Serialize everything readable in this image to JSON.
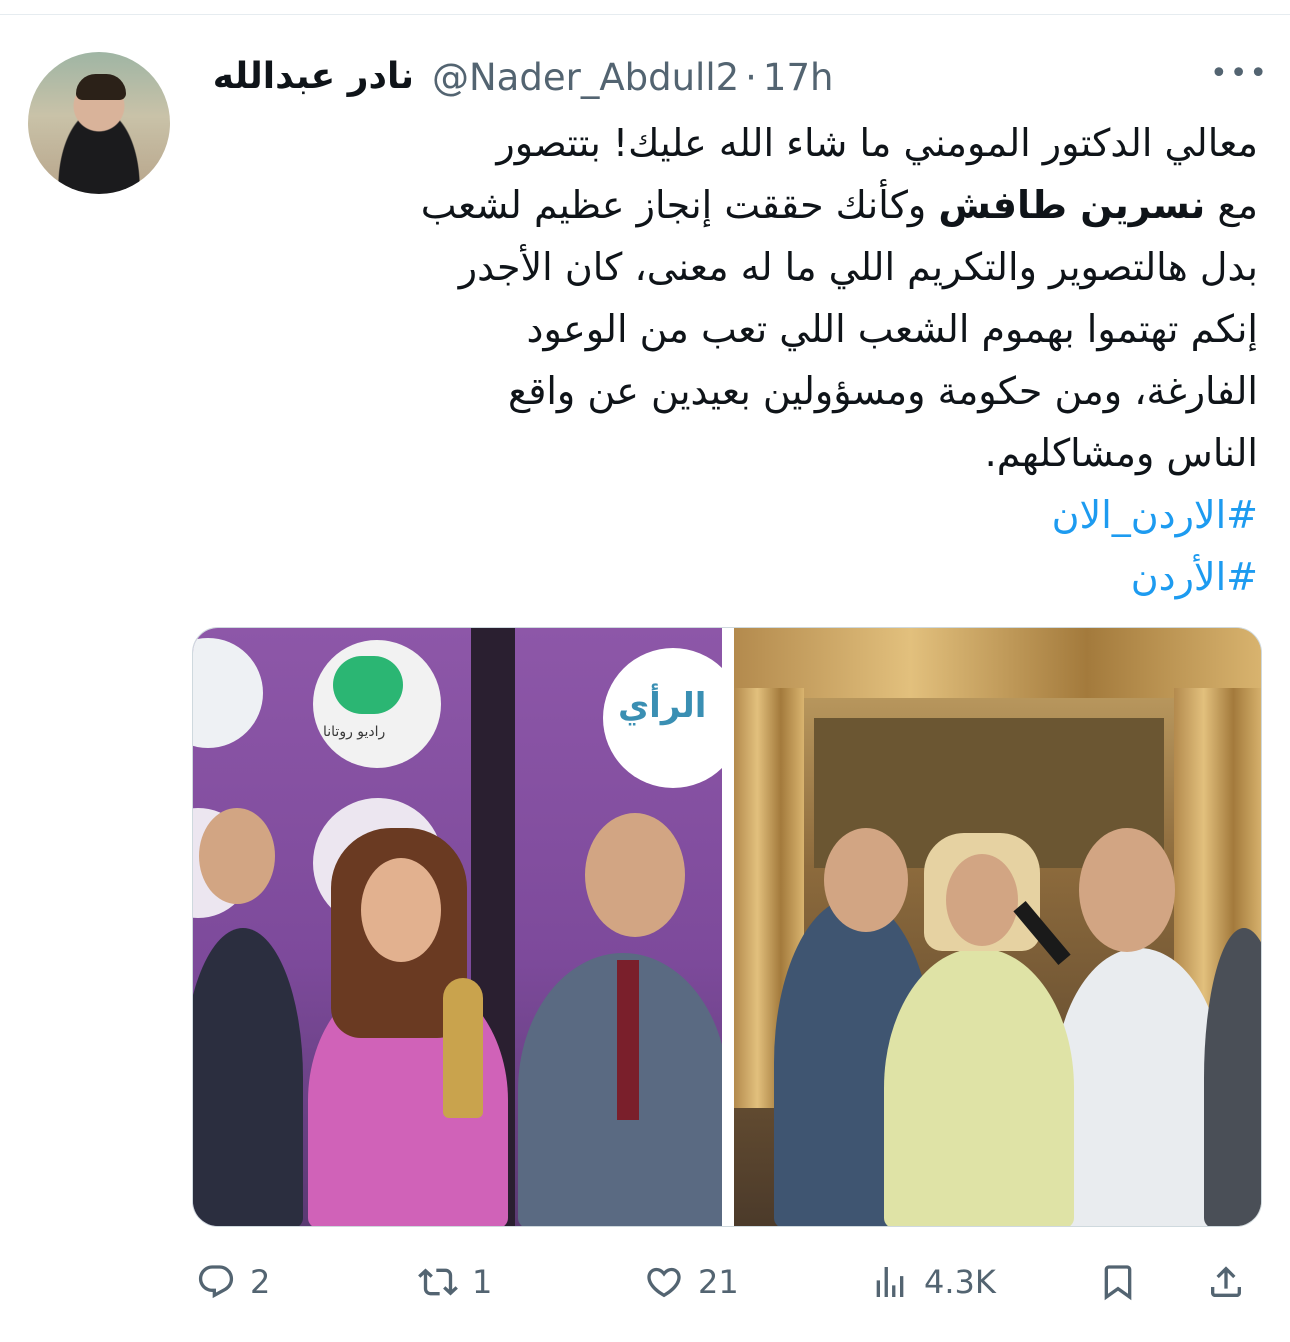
{
  "tweet": {
    "display_name": "نادر عبدالله",
    "handle": "@Nader_Abdull2",
    "separator": "·",
    "time": "17h",
    "more_label": "•••",
    "text_lines": [
      "معالي الدكتور المومني ما شاء الله عليك! بتتصور",
      "وكأنك حققت إنجاز عظيم لشعب",
      "بدل هالتصوير والتكريم اللي ما له معنى، كان الأجدر",
      "إنكم تهتموا بهموم الشعب اللي تعب من الوعود",
      "الفارغة، ومن حكومة ومسؤولين بعيدين عن واقع",
      "الناس ومشاكلهم."
    ],
    "line2_prefix": "مع",
    "line2_bold": "نسرين طافش",
    "hashtags": [
      "#الاردن_الان",
      "#الأردن"
    ]
  },
  "media": {
    "left_photo": {
      "logo_arabic": "الرأي",
      "rotana_text": "راديو روتانا"
    },
    "right_photo": {}
  },
  "actions": {
    "reply_count": "2",
    "retweet_count": "1",
    "like_count": "21",
    "views_count": "4.3K"
  },
  "colors": {
    "accent": "#1d9bf0",
    "secondary_text": "#536471",
    "primary_text": "#0f1419"
  },
  "icons": [
    "reply-icon",
    "retweet-icon",
    "like-icon",
    "views-icon",
    "bookmark-icon",
    "share-icon"
  ]
}
